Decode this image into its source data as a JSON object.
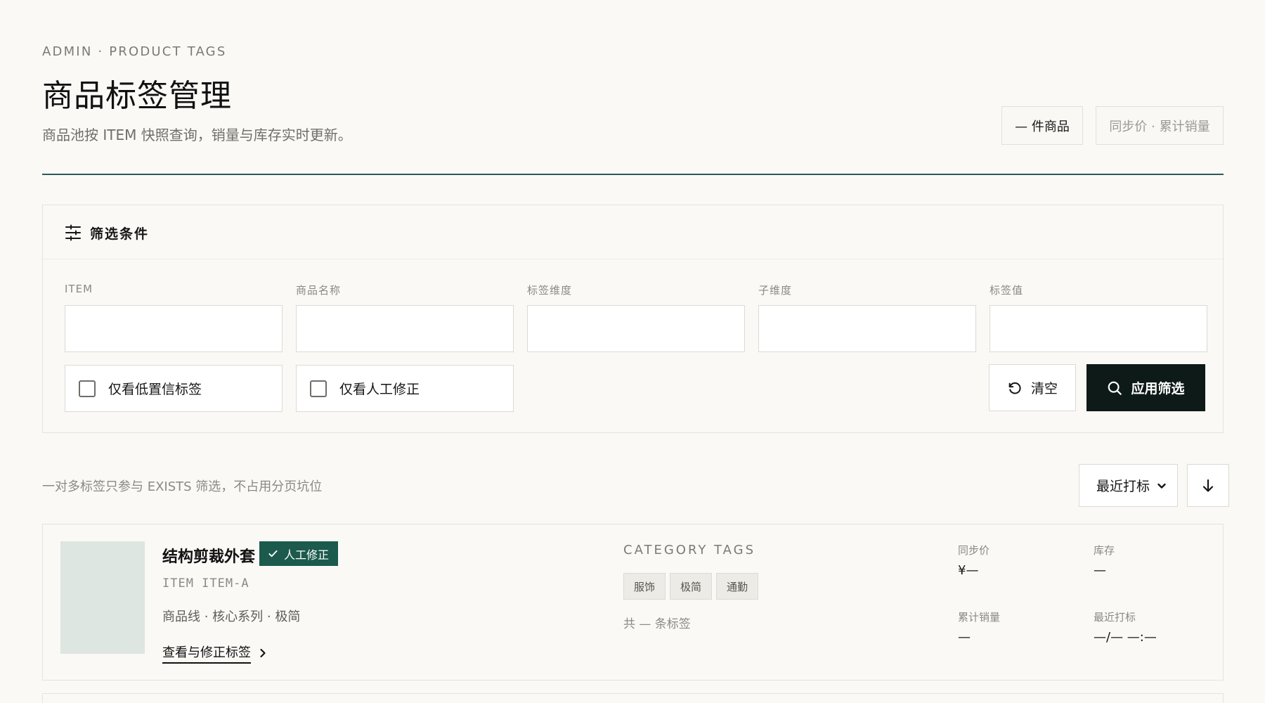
{
  "header": {
    "breadcrumb": "ADMIN · PRODUCT TAGS",
    "title": "商品标签管理",
    "subtitle": "商品池按 ITEM 快照查询，销量与库存实时更新。",
    "count_pill": "— 件商品",
    "sync_pill": "同步价 · 累计销量"
  },
  "filter": {
    "title": "筛选条件",
    "icon": "sliders-icon",
    "fields": [
      {
        "label": "ITEM",
        "value": "",
        "placeholder": ""
      },
      {
        "label": "商品名称",
        "value": "",
        "placeholder": ""
      },
      {
        "label": "标签维度",
        "value": "",
        "placeholder": ""
      },
      {
        "label": "子维度",
        "value": "",
        "placeholder": ""
      },
      {
        "label": "标签值",
        "value": "",
        "placeholder": ""
      }
    ],
    "checkboxes": [
      {
        "label": "仅看低置信标签",
        "checked": false
      },
      {
        "label": "仅看人工修正",
        "checked": false
      }
    ],
    "clear_label": "清空",
    "apply_label": "应用筛选"
  },
  "list": {
    "note": "一对多标签只参与 EXISTS 筛选，不占用分页坑位",
    "sort_selected": "最近打标",
    "sort_direction": "descending"
  },
  "products": [
    {
      "name": "结构剪裁外套",
      "badge": "人工修正",
      "item_code": "ITEM ITEM-A",
      "meta": "商品线 · 核心系列 · 极简",
      "link": "查看与修正标签",
      "category_heading": "CATEGORY TAGS",
      "tags": [
        "服饰",
        "极简",
        "通勤"
      ],
      "tag_count": "共 — 条标签",
      "stats": {
        "price_label": "同步价",
        "price": "¥—",
        "stock_label": "库存",
        "stock": "—",
        "sales_label": "累计销量",
        "sales": "—",
        "last_tag_label": "最近打标",
        "last_tag": "—/— —:—"
      }
    }
  ],
  "colors": {
    "accent": "#2d5a55",
    "badge": "#1b5a4c",
    "primary_button": "#0e1a17",
    "background": "#faf9f6"
  }
}
